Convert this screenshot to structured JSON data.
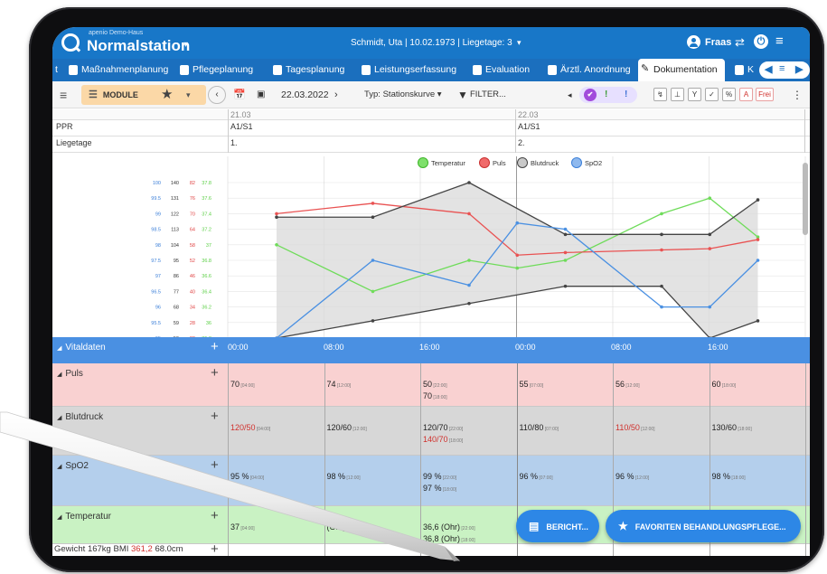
{
  "header": {
    "demo_house": "apenio Demo-Haus",
    "ward": "Normalstation",
    "patient": "Schmidt, Uta | 10.02.1973 | Liegetage: 3",
    "user": "Fraas"
  },
  "tabs": [
    {
      "label": "Maßnahmenplanung"
    },
    {
      "label": "Pflegeplanung"
    },
    {
      "label": "Tagesplanung"
    },
    {
      "label": "Leistungserfassung"
    },
    {
      "label": "Evaluation"
    },
    {
      "label": "Ärztl. Anordnung"
    },
    {
      "label": "Dokumentation",
      "active": true
    },
    {
      "label": "K"
    }
  ],
  "toolbar": {
    "module_label": "MODULE",
    "date": "22.03.2022",
    "type": "Typ: Stationskurve",
    "filter": "FILTER...",
    "badge_a": "A",
    "badge_frei": "Frei",
    "pill_exclaim": "!"
  },
  "info": {
    "day1_date": "21.03",
    "day2_date": "22.03",
    "ppr_label": "PPR",
    "ppr_day1": "A1/S1",
    "ppr_day2": "A1/S1",
    "liegetage_label": "Liegetage",
    "liegetage_day1": "1.",
    "liegetage_day2": "2."
  },
  "colors": {
    "header_blue": "#1877c8",
    "temp_green": "#6fdc5a",
    "pulse_red": "#e95252",
    "bp_gray": "#444444",
    "spo2_blue": "#4a90e2",
    "vital_bar": "#4a90e2",
    "puls_row": "#f9d1d1",
    "bp_row": "#d7d7d7",
    "spo2_row": "#b4cfec",
    "temp_row": "#c9f2c3"
  },
  "chart_data": {
    "type": "line",
    "legend": [
      "Temperatur",
      "Puls",
      "Blutdruck",
      "SpO2"
    ],
    "x": [
      "21.03 00:00",
      "21.03 08:00",
      "21.03 16:00",
      "22.03 00:00",
      "22.03 08:00",
      "22.03 16:00"
    ],
    "axes": {
      "spo2": [
        "100",
        "99.5",
        "99",
        "98.5",
        "98",
        "97.5",
        "97",
        "96.5",
        "96",
        "95.5",
        "95"
      ],
      "blutdruck": [
        "140",
        "131",
        "122",
        "113",
        "104",
        "95",
        "86",
        "77",
        "68",
        "59",
        "50"
      ],
      "puls": [
        "82",
        "76",
        "70",
        "64",
        "58",
        "52",
        "46",
        "40",
        "34",
        "28",
        "22"
      ],
      "temperatur": [
        "37.8",
        "37.6",
        "37.4",
        "37.2",
        "37",
        "36.8",
        "36.6",
        "36.4",
        "36.2",
        "36",
        "35.8"
      ]
    },
    "series": [
      {
        "name": "Temperatur",
        "points": [
          [
            0.0,
            37.0
          ],
          [
            1.0,
            36.4
          ],
          [
            2.0,
            36.8
          ],
          [
            2.5,
            36.7
          ],
          [
            3.0,
            36.8
          ],
          [
            4.0,
            37.4
          ],
          [
            4.5,
            37.6
          ],
          [
            5.0,
            37.1
          ]
        ]
      },
      {
        "name": "Puls",
        "points": [
          [
            0.0,
            70
          ],
          [
            1.0,
            74
          ],
          [
            2.0,
            70
          ],
          [
            2.5,
            54
          ],
          [
            3.0,
            55
          ],
          [
            4.0,
            56
          ],
          [
            4.5,
            56.5
          ],
          [
            5.0,
            60
          ]
        ]
      },
      {
        "name": "Blutdruck systolisch",
        "points": [
          [
            0.0,
            120
          ],
          [
            1.0,
            120
          ],
          [
            2.0,
            140
          ],
          [
            3.0,
            110
          ],
          [
            4.0,
            110
          ],
          [
            4.5,
            110
          ],
          [
            5.0,
            130
          ]
        ]
      },
      {
        "name": "Blutdruck diastolisch",
        "points": [
          [
            0.0,
            50
          ],
          [
            1.0,
            60
          ],
          [
            2.0,
            70
          ],
          [
            3.0,
            80
          ],
          [
            4.0,
            80
          ],
          [
            4.5,
            50
          ],
          [
            5.0,
            60
          ]
        ]
      },
      {
        "name": "SpO2",
        "points": [
          [
            0.0,
            95.0
          ],
          [
            1.0,
            97.5
          ],
          [
            2.0,
            96.7
          ],
          [
            2.5,
            98.7
          ],
          [
            3.0,
            98.5
          ],
          [
            4.0,
            96.0
          ],
          [
            4.5,
            96.0
          ],
          [
            5.0,
            97.5
          ]
        ]
      }
    ]
  },
  "grid": {
    "vitaldaten": "Vitaldaten",
    "times": [
      "00:00",
      "08:00",
      "16:00",
      "00:00",
      "08:00",
      "16:00"
    ],
    "puls_label": "Puls",
    "puls": [
      {
        "v": "70",
        "t": "[04:00]"
      },
      {
        "v": "74",
        "t": "[12:00]"
      },
      {
        "v": "50",
        "t": "[22:00]",
        "v2": "70",
        "t2": "[18:00]"
      },
      {
        "v": "55",
        "t": "[07:00]"
      },
      {
        "v": "56",
        "t": "[12:00]"
      },
      {
        "v": "60",
        "t": "[18:00]"
      }
    ],
    "blutdruck_label": "Blutdruck",
    "blutdruck": [
      {
        "v": "120/50",
        "t": "[04:00]",
        "red": true
      },
      {
        "v": "120/60",
        "t": "[12:00]"
      },
      {
        "v": "120/70",
        "t": "[22:00]",
        "v2": "140/70",
        "t2": "[18:00]",
        "red2": true
      },
      {
        "v": "110/80",
        "t": "[07:00]"
      },
      {
        "v": "110/50",
        "t": "[12:00]",
        "red": true
      },
      {
        "v": "130/60",
        "t": "[18:00]"
      }
    ],
    "spo2_label": "SpO2",
    "spo2": [
      {
        "v": "95 %",
        "t": "[04:00]"
      },
      {
        "v": "98 %",
        "t": "[12:00]"
      },
      {
        "v": "99 %",
        "t": "[22:00]",
        "v2": "97 %",
        "t2": "[18:00]"
      },
      {
        "v": "96 %",
        "t": "[07:00]"
      },
      {
        "v": "96 %",
        "t": "[12:00]"
      },
      {
        "v": "98 %",
        "t": "[18:00]"
      }
    ],
    "temperatur_label": "Temperatur",
    "temperatur": [
      {
        "v": "37",
        "t": "[04:00]"
      },
      {
        "v": "(Ohr)",
        "t": "[12:00]"
      },
      {
        "v": "36,6 (Ohr)",
        "t": "[22:00]",
        "v2": "36,8 (Ohr)",
        "t2": "[18:00]"
      }
    ],
    "gewicht_prefix": "Gewicht 167kg BMI",
    "gewicht_bmi": "361,2",
    "gewicht_suffix": "68.0cm",
    "gewicht_cell": "kg"
  },
  "fabs": {
    "bericht": "BERICHT...",
    "favoriten": "FAVORITEN BEHANDLUNGSPFLEGE..."
  }
}
